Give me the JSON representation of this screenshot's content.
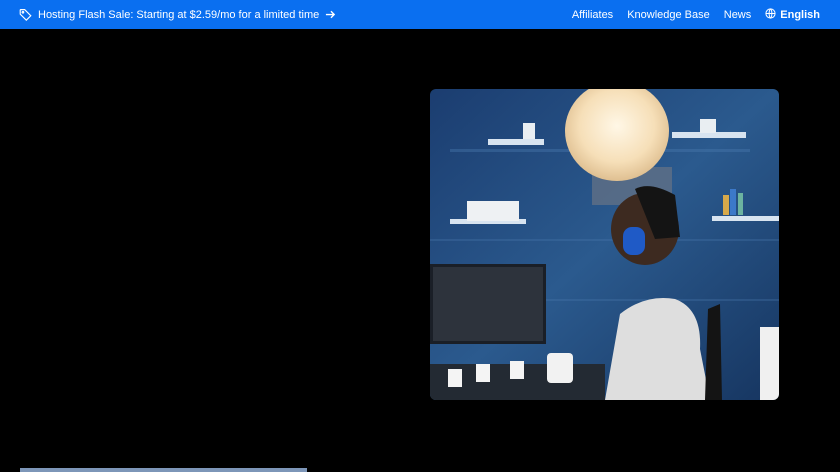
{
  "topbar": {
    "promo_text": "Hosting Flash Sale: Starting at $2.59/mo for a limited time",
    "nav": [
      "Affiliates",
      "Knowledge Base",
      "News"
    ],
    "language": "English",
    "colors": {
      "bar": "#0a6ff0",
      "text": "#ffffff"
    }
  },
  "hero": {
    "image_icon": "photo",
    "page_background": "#000000"
  }
}
